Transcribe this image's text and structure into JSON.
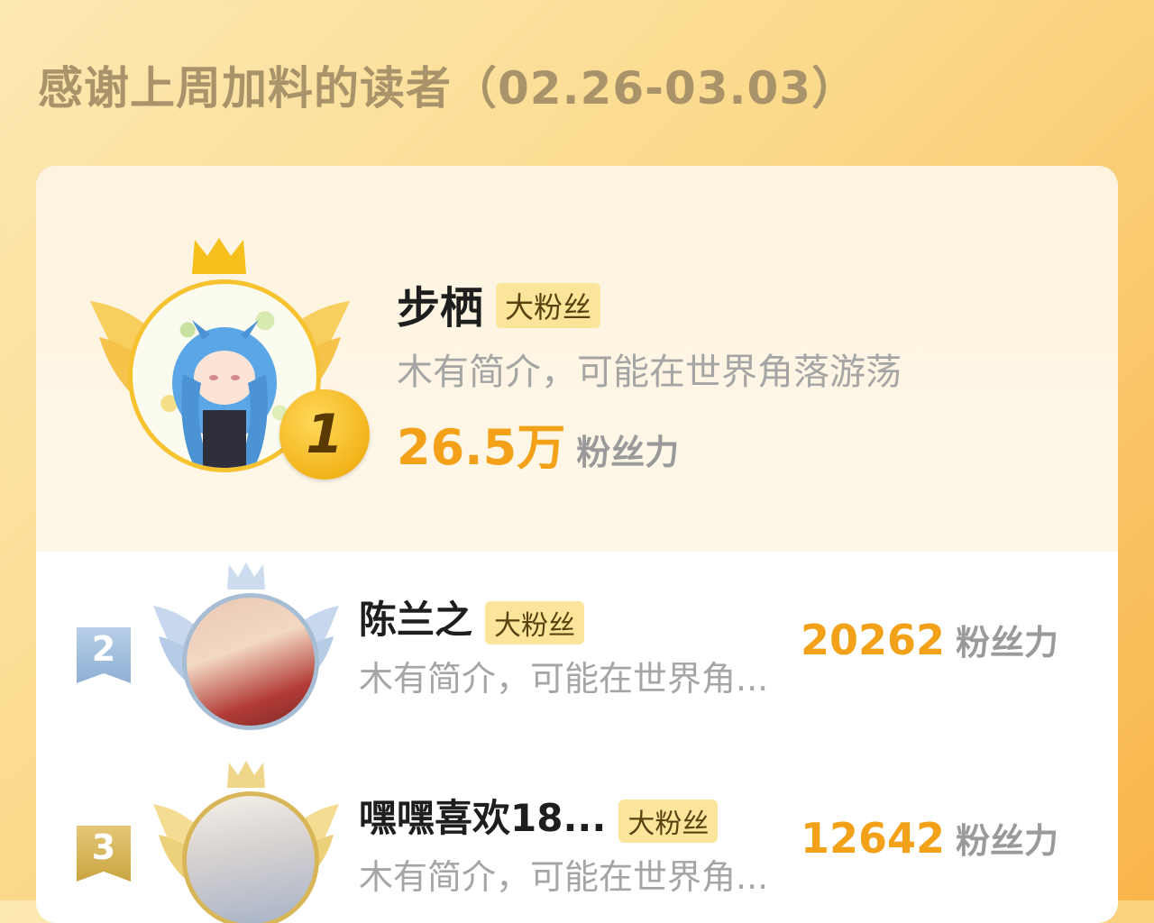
{
  "page": {
    "title": "感谢上周加料的读者（02.26-03.03）"
  },
  "colors": {
    "accent": "#f2a118",
    "tag_bg": "#fbe59a",
    "gold": "#f7c230",
    "silver": "#a7bdd3",
    "bronze": "#d8b556"
  },
  "top_reader": {
    "rank": "1",
    "name": "步栖",
    "tag": "大粉丝",
    "description": "木有简介，可能在世界角落游荡",
    "power_value": "26.5万",
    "power_label": "粉丝力",
    "avatar_icon": "anime-avatar-icon"
  },
  "readers": [
    {
      "rank": "2",
      "name": "陈兰之",
      "tag": "大粉丝",
      "description": "木有简介，可能在世界角...",
      "power_value": "20262",
      "power_label": "粉丝力"
    },
    {
      "rank": "3",
      "name": "嘿嘿喜欢18...",
      "tag": "大粉丝",
      "description": "木有简介，可能在世界角...",
      "power_value": "12642",
      "power_label": "粉丝力"
    }
  ]
}
